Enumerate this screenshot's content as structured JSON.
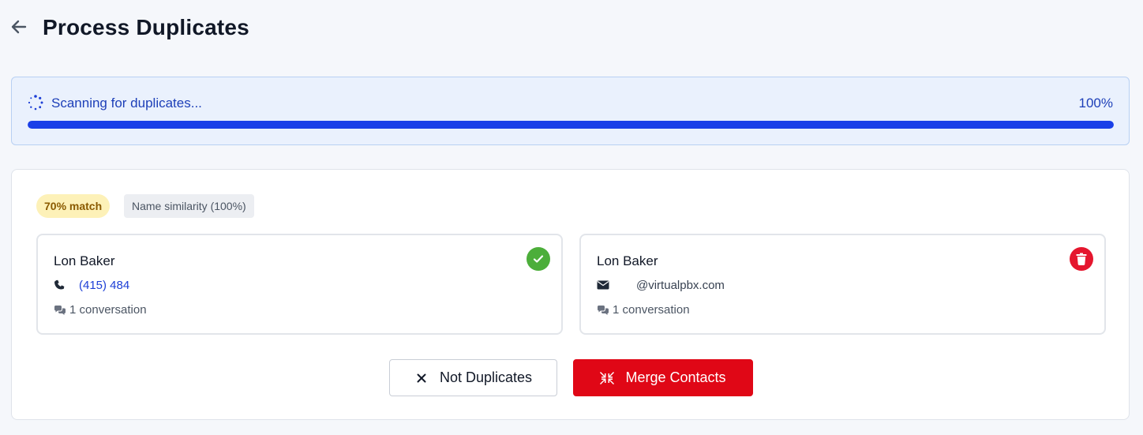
{
  "header": {
    "title": "Process Duplicates",
    "back_icon": "arrow-left-icon"
  },
  "scan": {
    "label": "Scanning for duplicates...",
    "percent_label": "100%",
    "progress_fraction": 1.0,
    "accent_color": "#1a3fe8",
    "spinner_icon": "spinner-icon"
  },
  "duplicate_group": {
    "match_badge": "70% match",
    "reason_badge": "Name similarity (100%)",
    "contacts": [
      {
        "name": "Lon Baker",
        "detail_icon": "phone-icon",
        "detail": "(415) 484",
        "conversations": "1 conversation",
        "status_icon": "check-circle-icon",
        "status_color": "#4cae3a"
      },
      {
        "name": "Lon Baker",
        "detail_icon": "envelope-icon",
        "detail": "@virtualpbx.com",
        "conversations": "1 conversation",
        "status_icon": "trash-icon",
        "status_color": "#e5162e"
      }
    ],
    "actions": {
      "not_duplicates": "Not Duplicates",
      "merge": "Merge Contacts",
      "merge_color": "#e00716"
    }
  }
}
